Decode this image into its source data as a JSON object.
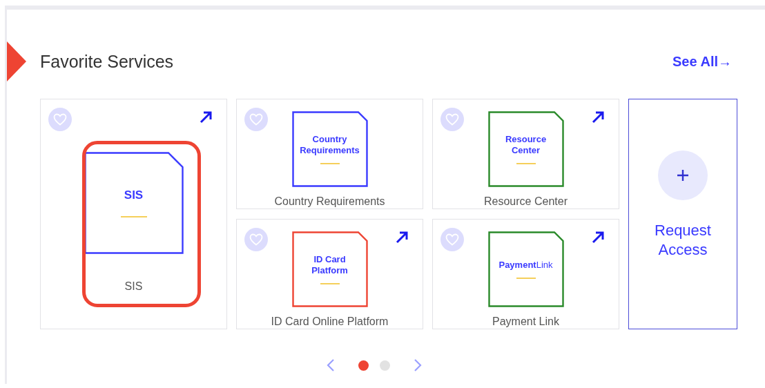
{
  "section": {
    "title": "Favorite Services",
    "see_all": "See All→"
  },
  "services": [
    {
      "kind": "large",
      "name": "SIS",
      "tile_text": "SIS",
      "tile_bold": true,
      "color": "#3a3aff",
      "external": true,
      "highlighted": true
    },
    {
      "kind": "small",
      "name": "Country Requirements",
      "tile_text": "Country Requirements",
      "tile_bold": true,
      "color": "#3a3aff",
      "external": false,
      "highlighted": false
    },
    {
      "kind": "small",
      "name": "Resource Center",
      "tile_text": "Resource Center",
      "tile_bold": true,
      "color": "#2a8a2a",
      "external": true,
      "highlighted": false
    },
    {
      "kind": "small",
      "name": "ID Card Online Platform",
      "tile_text": "ID Card Platform",
      "tile_bold": true,
      "color": "#ee4433",
      "external": true,
      "highlighted": false
    },
    {
      "kind": "small",
      "name": "Payment Link",
      "tile_text": "**Payment**Link",
      "tile_bold": false,
      "color": "#2a8a2a",
      "external": true,
      "highlighted": false
    }
  ],
  "request_access": {
    "label": "Request Access"
  },
  "pager": {
    "dots": [
      {
        "selected": true
      },
      {
        "selected": false
      }
    ]
  }
}
